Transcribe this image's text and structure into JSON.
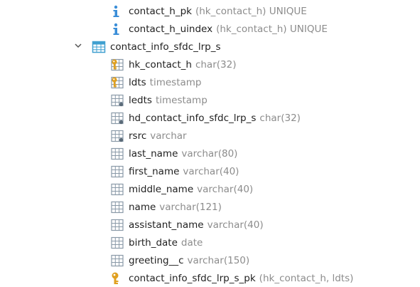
{
  "tree": {
    "index_1": {
      "name": "contact_h_pk",
      "detail": "(hk_contact_h) UNIQUE",
      "icon": "index-info-icon"
    },
    "index_2": {
      "name": "contact_h_uindex",
      "detail": "(hk_contact_h) UNIQUE",
      "icon": "index-info-icon"
    },
    "table": {
      "name": "contact_info_sfdc_lrp_s",
      "icon": "table-icon",
      "expanded": true
    },
    "columns": [
      {
        "name": "hk_contact_h",
        "type": "char(32)",
        "icon": "primary-key-column-icon"
      },
      {
        "name": "ldts",
        "type": "timestamp",
        "icon": "primary-key-column-icon"
      },
      {
        "name": "ledts",
        "type": "timestamp",
        "icon": "column-notnull-icon"
      },
      {
        "name": "hd_contact_info_sfdc_lrp_s",
        "type": "char(32)",
        "icon": "column-notnull-icon"
      },
      {
        "name": "rsrc",
        "type": "varchar",
        "icon": "column-notnull-icon"
      },
      {
        "name": "last_name",
        "type": "varchar(80)",
        "icon": "column-icon"
      },
      {
        "name": "first_name",
        "type": "varchar(40)",
        "icon": "column-icon"
      },
      {
        "name": "middle_name",
        "type": "varchar(40)",
        "icon": "column-icon"
      },
      {
        "name": "name",
        "type": "varchar(121)",
        "icon": "column-icon"
      },
      {
        "name": "assistant_name",
        "type": "varchar(40)",
        "icon": "column-icon"
      },
      {
        "name": "birth_date",
        "type": "date",
        "icon": "column-icon"
      },
      {
        "name": "greeting__c",
        "type": "varchar(150)",
        "icon": "column-icon"
      }
    ],
    "primary_key": {
      "name": "contact_info_sfdc_lrp_s_pk",
      "detail": "(hk_contact_h, ldts)",
      "icon": "key-icon"
    }
  },
  "colors": {
    "text": "#1f1f1f",
    "muted": "#8c8c8c",
    "table_blue": "#40a0d0",
    "grid_gray": "#8a9aa8",
    "key_gold": "#e0a020",
    "info_blue": "#3a8ed8"
  }
}
